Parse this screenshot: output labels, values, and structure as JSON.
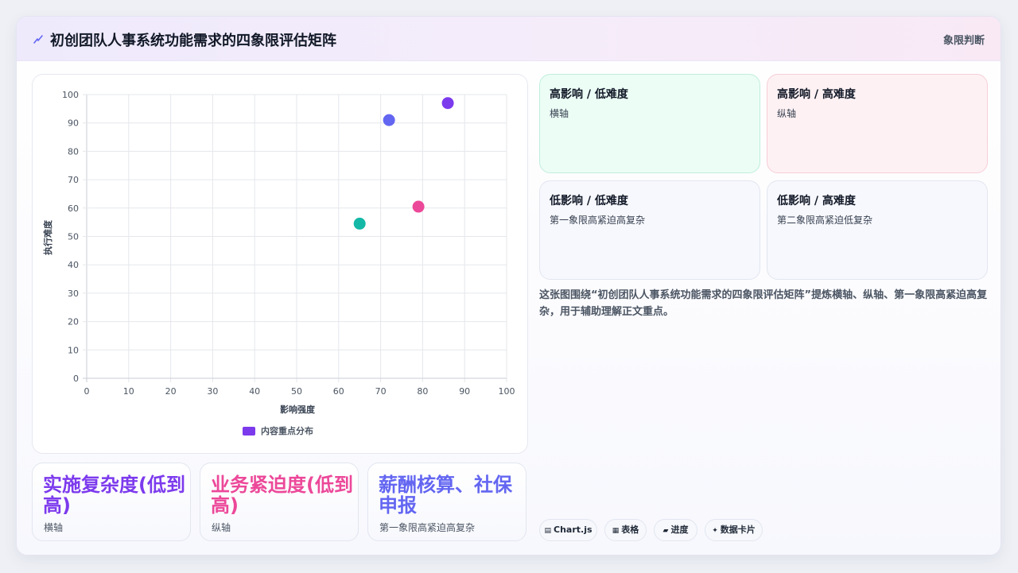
{
  "header": {
    "icon": "lightning-icon",
    "title": "初创团队人事系统功能需求的四象限评估矩阵",
    "tag": "象限判断"
  },
  "chart_data": {
    "type": "scatter",
    "xlabel": "影响强度",
    "ylabel": "执行难度",
    "xlim": [
      0,
      100
    ],
    "ylim": [
      0,
      100
    ],
    "xticks": [
      "0",
      "10",
      "20",
      "30",
      "40",
      "50",
      "60",
      "70",
      "80",
      "90",
      "100"
    ],
    "yticks": [
      "0",
      "10",
      "20",
      "30",
      "40",
      "50",
      "60",
      "70",
      "80",
      "90",
      "100"
    ],
    "grid": true,
    "legend_position": "bottom",
    "series": [
      {
        "name": "内容重点分布",
        "legend_color": "#7c3aed",
        "points": [
          {
            "x": 65,
            "y": 54.5,
            "color": "#14b8a6"
          },
          {
            "x": 72,
            "y": 91,
            "color": "#6366f1"
          },
          {
            "x": 79,
            "y": 60.5,
            "color": "#ec4899"
          },
          {
            "x": 86,
            "y": 97,
            "color": "#7c3aed"
          }
        ]
      }
    ]
  },
  "stats": [
    {
      "value": "实施复杂度(低到高)",
      "label": "横轴",
      "color": "#7c3aed"
    },
    {
      "value": "业务紧迫度(低到高)",
      "label": "纵轴",
      "color": "#ec4899"
    },
    {
      "value": "薪酬核算、社保申报",
      "label": "第一象限高紧迫高复杂",
      "color": "#6366f1"
    }
  ],
  "quadrants": [
    {
      "title": "高影响 / 低难度",
      "body": "横轴",
      "bg": "#ecfdf5",
      "border": "#bfeedd"
    },
    {
      "title": "高影响 / 高难度",
      "body": "纵轴",
      "bg": "#fef1f3",
      "border": "#f6cfd7"
    },
    {
      "title": "低影响 / 低难度",
      "body": "第一象限高紧迫高复杂",
      "bg": "#f7f8fd",
      "border": "#e2e6f0"
    },
    {
      "title": "低影响 / 高难度",
      "body": "第二象限高紧迫低复杂",
      "bg": "#f7f8fd",
      "border": "#e2e6f0"
    }
  ],
  "description": "这张图围绕“初创团队人事系统功能需求的四象限评估矩阵”提炼横轴、纵轴、第一象限高紧迫高复杂，用于辅助理解正文重点。",
  "chips": [
    {
      "icon": "chart-icon",
      "glyph": "▤",
      "label": "Chart.js"
    },
    {
      "icon": "table-icon",
      "glyph": "▦",
      "label": "表格"
    },
    {
      "icon": "progress-icon",
      "glyph": "▰",
      "label": "进度"
    },
    {
      "icon": "sparkle-icon",
      "glyph": "✦",
      "label": "数据卡片"
    }
  ]
}
